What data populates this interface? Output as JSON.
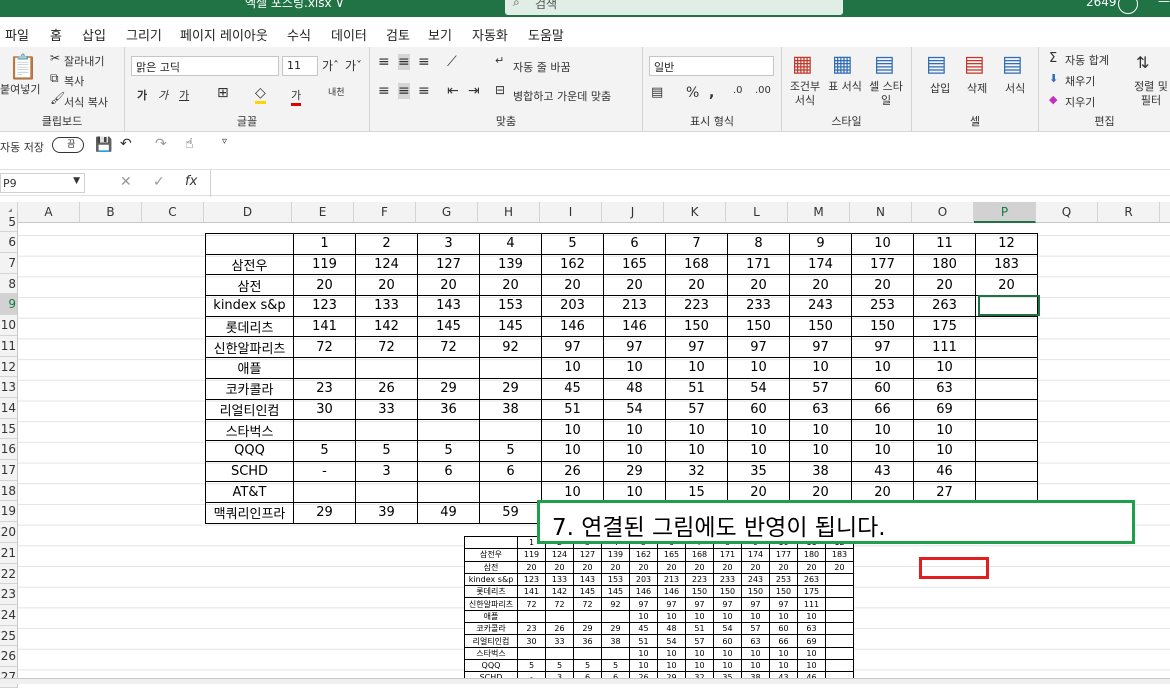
{
  "titlebar": {
    "file_title": "엑셀 포스팅.xlsx ∨",
    "search_placeholder": "검색",
    "count": "2649"
  },
  "tabs": [
    "파일",
    "홈",
    "삽입",
    "그리기",
    "페이지 레이아웃",
    "수식",
    "데이터",
    "검토",
    "보기",
    "자동화",
    "도움말"
  ],
  "ribbon": {
    "clipboard": {
      "paste": "붙여넣기",
      "cut": "잘라내기",
      "copy": "복사",
      "format_painter": "서식 복사",
      "label": "클립보드"
    },
    "font": {
      "name": "맑은 고딕",
      "size": "11",
      "label": "글꼴"
    },
    "align": {
      "wrap": "자동 줄 바꿈",
      "merge": "병합하고 가운데 맞춤",
      "label": "맞춤"
    },
    "number": {
      "format": "일반",
      "label": "표시 형식"
    },
    "styles": {
      "cond": "조건부 서식",
      "table": "표 서식",
      "cell": "셀 스타일",
      "label": "스타일"
    },
    "cells": {
      "insert": "삽입",
      "delete": "삭제",
      "format": "서식",
      "label": "셀"
    },
    "editing": {
      "autosum": "자동 합계",
      "fill": "채우기",
      "clear": "지우기",
      "sort": "정렬 및 필터",
      "label": "편집"
    }
  },
  "qat": {
    "autosave": "자동 저장",
    "toggle": "끔"
  },
  "formula_bar": {
    "namebox": "P9",
    "fx": "fx",
    "value": ""
  },
  "columns": [
    "A",
    "B",
    "C",
    "D",
    "E",
    "F",
    "G",
    "H",
    "I",
    "J",
    "K",
    "L",
    "M",
    "N",
    "O",
    "P",
    "Q",
    "R"
  ],
  "rows": [
    "5",
    "6",
    "7",
    "8",
    "9",
    "10",
    "11",
    "12",
    "13",
    "14",
    "15",
    "16",
    "17",
    "18",
    "19",
    "20",
    "21",
    "22",
    "23",
    "24",
    "25",
    "26",
    "27"
  ],
  "table": {
    "header": [
      "1",
      "2",
      "3",
      "4",
      "5",
      "6",
      "7",
      "8",
      "9",
      "10",
      "11",
      "12"
    ],
    "rows": [
      {
        "name": "삼전우",
        "v": [
          "119",
          "124",
          "127",
          "139",
          "162",
          "165",
          "168",
          "171",
          "174",
          "177",
          "180",
          "183"
        ]
      },
      {
        "name": "삼전",
        "v": [
          "20",
          "20",
          "20",
          "20",
          "20",
          "20",
          "20",
          "20",
          "20",
          "20",
          "20",
          "20"
        ]
      },
      {
        "name": "kindex s&p",
        "v": [
          "123",
          "133",
          "143",
          "153",
          "203",
          "213",
          "223",
          "233",
          "243",
          "253",
          "263",
          ""
        ]
      },
      {
        "name": "롯데리츠",
        "v": [
          "141",
          "142",
          "145",
          "145",
          "146",
          "146",
          "150",
          "150",
          "150",
          "150",
          "175",
          ""
        ]
      },
      {
        "name": "신한알파리츠",
        "v": [
          "72",
          "72",
          "72",
          "92",
          "97",
          "97",
          "97",
          "97",
          "97",
          "97",
          "111",
          ""
        ]
      },
      {
        "name": "애플",
        "v": [
          "",
          "",
          "",
          "",
          "10",
          "10",
          "10",
          "10",
          "10",
          "10",
          "10",
          ""
        ]
      },
      {
        "name": "코카콜라",
        "v": [
          "23",
          "26",
          "29",
          "29",
          "45",
          "48",
          "51",
          "54",
          "57",
          "60",
          "63",
          ""
        ]
      },
      {
        "name": "리얼티인컴",
        "v": [
          "30",
          "33",
          "36",
          "38",
          "51",
          "54",
          "57",
          "60",
          "63",
          "66",
          "69",
          ""
        ]
      },
      {
        "name": "스타벅스",
        "v": [
          "",
          "",
          "",
          "",
          "10",
          "10",
          "10",
          "10",
          "10",
          "10",
          "10",
          ""
        ]
      },
      {
        "name": "QQQ",
        "v": [
          "5",
          "5",
          "5",
          "5",
          "10",
          "10",
          "10",
          "10",
          "10",
          "10",
          "10",
          ""
        ]
      },
      {
        "name": "SCHD",
        "v": [
          "-",
          "3",
          "6",
          "6",
          "26",
          "29",
          "32",
          "35",
          "38",
          "43",
          "46",
          ""
        ]
      },
      {
        "name": "AT&T",
        "v": [
          "",
          "",
          "",
          "",
          "10",
          "10",
          "15",
          "20",
          "20",
          "20",
          "27",
          ""
        ]
      },
      {
        "name": "맥쿼리인프라",
        "v": [
          "29",
          "39",
          "49",
          "59",
          "",
          "",
          "",
          "",
          "",
          "",
          "",
          ""
        ]
      }
    ]
  },
  "callout": "7. 연결된 그림에도 반영이 됩니다."
}
